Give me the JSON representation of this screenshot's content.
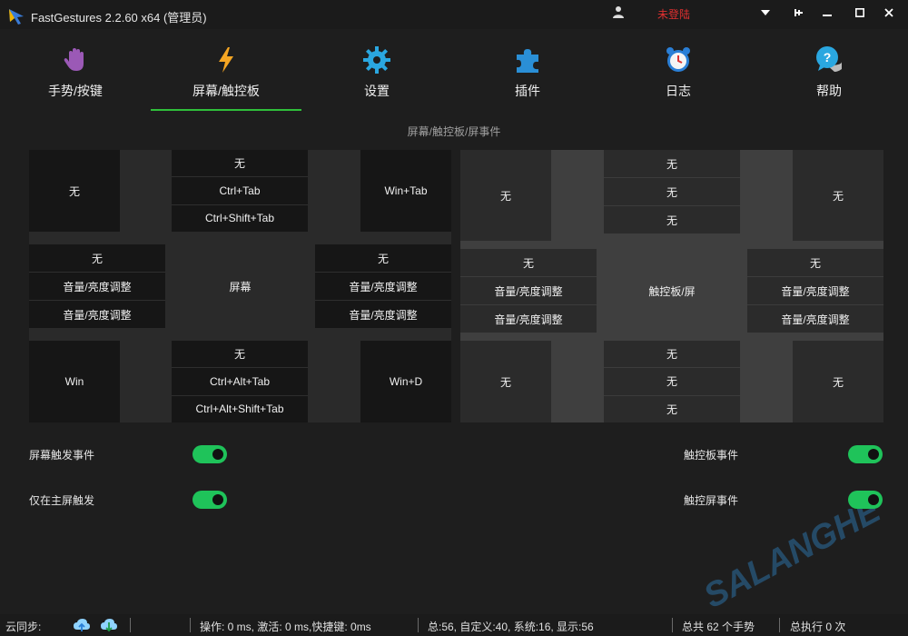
{
  "window": {
    "title": "FastGestures 2.2.60 x64  (管理员)",
    "login_status": "未登陆",
    "accent_color": "#2fbf3b",
    "toggle_color": "#1fc35a"
  },
  "tabs": [
    {
      "label": "手势/按键",
      "icon": "hand-icon",
      "active": false
    },
    {
      "label": "屏幕/触控板",
      "icon": "lightning-icon",
      "active": true
    },
    {
      "label": "设置",
      "icon": "gear-icon",
      "active": false
    },
    {
      "label": "插件",
      "icon": "puzzle-icon",
      "active": false
    },
    {
      "label": "日志",
      "icon": "alarm-clock-icon",
      "active": false
    },
    {
      "label": "帮助",
      "icon": "help-bubble-icon",
      "active": false
    }
  ],
  "section_title": "屏幕/触控板/屏事件",
  "screen": {
    "center": "屏幕",
    "top_left": "无",
    "top_center": [
      "无",
      "Ctrl+Tab",
      "Ctrl+Shift+Tab"
    ],
    "top_right": "Win+Tab",
    "left": [
      "无",
      "音量/亮度调整",
      "音量/亮度调整"
    ],
    "right": [
      "无",
      "音量/亮度调整",
      "音量/亮度调整"
    ],
    "bottom_left": "Win",
    "bottom_center": [
      "无",
      "Ctrl+Alt+Tab",
      "Ctrl+Alt+Shift+Tab"
    ],
    "bottom_right": "Win+D"
  },
  "touchpad": {
    "center": "触控板/屏",
    "top_left": "无",
    "top_center": [
      "无",
      "无",
      "无"
    ],
    "top_right": "无",
    "left": [
      "无",
      "音量/亮度调整",
      "音量/亮度调整"
    ],
    "right": [
      "无",
      "音量/亮度调整",
      "音量/亮度调整"
    ],
    "bottom_left": "无",
    "bottom_center": [
      "无",
      "无",
      "无"
    ],
    "bottom_right": "无"
  },
  "toggles": {
    "screen_event": {
      "label": "屏幕触发事件",
      "on": true
    },
    "main_screen_only": {
      "label": "仅在主屏触发",
      "on": true
    },
    "touchpad_event": {
      "label": "触控板事件",
      "on": true
    },
    "touchscreen_event": {
      "label": "触控屏事件",
      "on": true
    }
  },
  "watermark": "SALANGHE",
  "statusbar": {
    "sync_label": "云同步:",
    "timing": "操作: 0 ms, 激活: 0 ms,快捷键: 0ms",
    "counts": "总:56, 自定义:40, 系统:16, 显示:56",
    "total_gestures": "总共 62 个手势",
    "total_exec": "总执行 0 次"
  }
}
